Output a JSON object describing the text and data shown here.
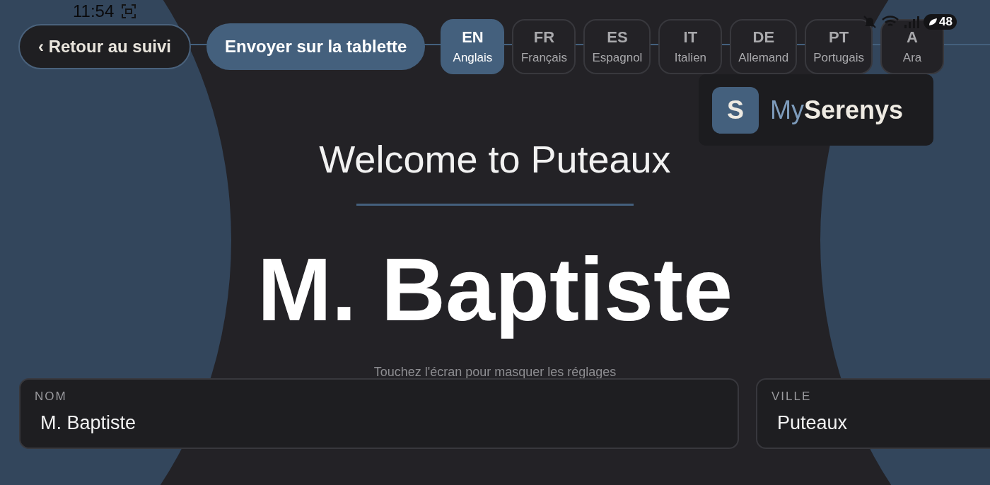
{
  "status_bar": {
    "time": "11:54",
    "battery": "48"
  },
  "back_button": {
    "label": "‹ Retour au suivi"
  },
  "send_button": {
    "label": "Envoyer sur la tablette"
  },
  "languages": [
    {
      "code": "EN",
      "name": "Anglais",
      "selected": true
    },
    {
      "code": "FR",
      "name": "Français",
      "selected": false
    },
    {
      "code": "ES",
      "name": "Espagnol",
      "selected": false
    },
    {
      "code": "IT",
      "name": "Italien",
      "selected": false
    },
    {
      "code": "DE",
      "name": "Allemand",
      "selected": false
    },
    {
      "code": "PT",
      "name": "Portugais",
      "selected": false
    },
    {
      "code": "A",
      "name": "Ara",
      "selected": false
    }
  ],
  "brand": {
    "letter": "S",
    "prefix": "My",
    "name": "Serenys"
  },
  "title": "Welcome to Puteaux",
  "name_display": "M. Baptiste",
  "hint": "Touchez l'écran pour masquer les réglages",
  "fields": [
    {
      "label": "NOM",
      "value": "M. Baptiste"
    },
    {
      "label": "VILLE",
      "value": "Puteaux"
    }
  ]
}
